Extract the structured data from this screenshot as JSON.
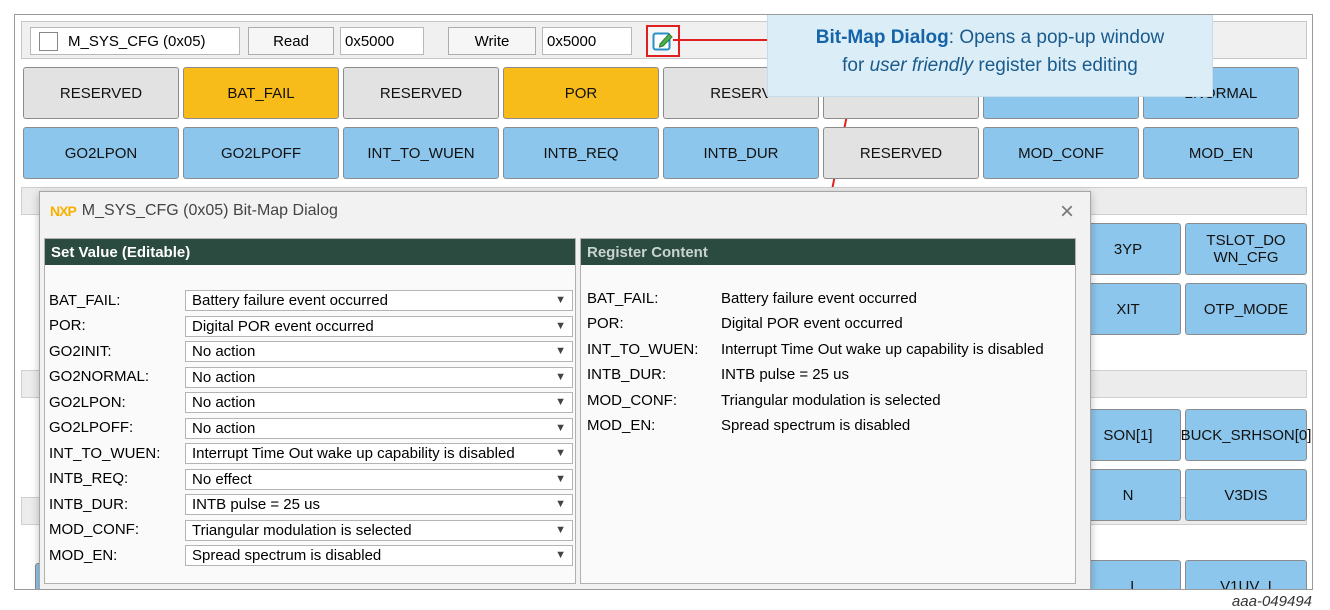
{
  "toolbar": {
    "register_name": "M_SYS_CFG (0x05)",
    "read_label": "Read",
    "read_value": "0x5000",
    "write_label": "Write",
    "write_value": "0x5000",
    "edit_icon": "edit-icon"
  },
  "callout": {
    "title": "Bit-Map Dialog",
    "text_a": ": Opens a pop-up window",
    "text_b": "for ",
    "emph": "user friendly",
    "text_c": " register bits editing"
  },
  "row1": [
    "RESERVED",
    "BAT_FAIL",
    "RESERVED",
    "POR",
    "RESERV",
    "",
    "",
    "2NORMAL"
  ],
  "row2": [
    "GO2LPON",
    "GO2LPOFF",
    "INT_TO_WUEN",
    "INTB_REQ",
    "INTB_DUR",
    "RESERVED",
    "MOD_CONF",
    "MOD_EN"
  ],
  "right_buttons": [
    "3YP",
    "TSLOT_DO WN_CFG",
    "XIT",
    "OTP_MODE",
    "SON[1]",
    "BUCK_SRHSON[0]",
    "N",
    "V3DIS",
    "_I",
    "V1UV_I"
  ],
  "colors": {
    "gray": "#e2e2e2",
    "orange": "#f7bb1a",
    "blue": "#8cc6ec",
    "header": "#2b4a40",
    "highlight": "#e02020"
  },
  "dialog": {
    "logo": "NXP",
    "title": "M_SYS_CFG (0x05) Bit-Map Dialog",
    "close": "×",
    "left_header": "Set Value (Editable)",
    "right_header": "Register Content",
    "fields": [
      {
        "label": "BAT_FAIL:",
        "value": "Battery failure event occurred"
      },
      {
        "label": "POR:",
        "value": "Digital POR event occurred"
      },
      {
        "label": "GO2INIT:",
        "value": "No action"
      },
      {
        "label": "GO2NORMAL:",
        "value": "No action"
      },
      {
        "label": "GO2LPON:",
        "value": "No action"
      },
      {
        "label": "GO2LPOFF:",
        "value": "No action"
      },
      {
        "label": "INT_TO_WUEN:",
        "value": "Interrupt Time Out wake up capability is disabled"
      },
      {
        "label": "INTB_REQ:",
        "value": "No effect"
      },
      {
        "label": "INTB_DUR:",
        "value": "INTB pulse = 25 us"
      },
      {
        "label": "MOD_CONF:",
        "value": "Triangular modulation is selected"
      },
      {
        "label": "MOD_EN:",
        "value": "Spread spectrum is disabled"
      }
    ],
    "content": [
      {
        "label": "BAT_FAIL:",
        "value": "Battery failure event occurred"
      },
      {
        "label": "POR:",
        "value": "Digital POR event occurred"
      },
      {
        "label": "INT_TO_WUEN:",
        "value": "Interrupt Time Out wake up capability is disabled"
      },
      {
        "label": "INTB_DUR:",
        "value": "INTB pulse = 25 us"
      },
      {
        "label": "MOD_CONF:",
        "value": "Triangular modulation is selected"
      },
      {
        "label": "MOD_EN:",
        "value": "Spread spectrum is disabled"
      }
    ]
  },
  "caption": "aaa-049494"
}
